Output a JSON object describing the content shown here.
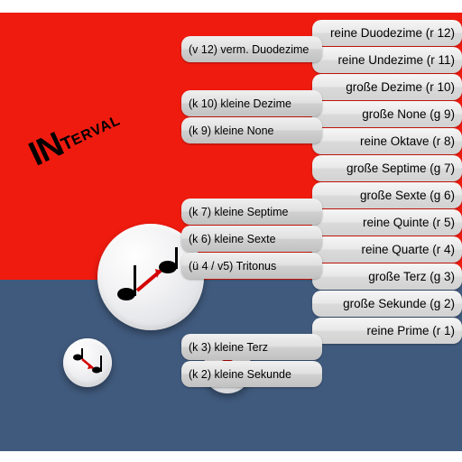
{
  "title": {
    "big": "IN",
    "med": "T",
    "small": "ERVAL"
  },
  "right_list": [
    "reine Duodezime (r 12)",
    "reine Undezime (r 11)",
    "große Dezime (r 10)",
    "große None (g 9)",
    "reine Oktave (r 8)",
    "große Septime (g 7)",
    "große Sexte (g 6)",
    "reine Quinte (r 5)",
    "reine Quarte (r 4)",
    "große Terz (g 3)",
    "große Sekunde (g 2)",
    "reine Prime (r 1)"
  ],
  "left_blocks": [
    {
      "items": [
        "(v 12) verm. Duodezime"
      ]
    },
    {
      "items": [
        "(k 10) kleine Dezime",
        "(k 9) kleine None"
      ]
    },
    {
      "items": [
        "(k 7) kleine Septime",
        "(k 6) kleine Sexte",
        "(ü 4 / v5) Tritonus"
      ]
    },
    {
      "items": [
        "(k 3) kleine Terz",
        "(k 2) kleine Sekunde"
      ]
    }
  ],
  "buttons": {
    "big": "interval-up",
    "small_left": "interval-down",
    "small_right": "whole-note"
  },
  "colors": {
    "red": "#f01b0f",
    "blue": "#405a7d",
    "button": "#e8e8ea"
  }
}
